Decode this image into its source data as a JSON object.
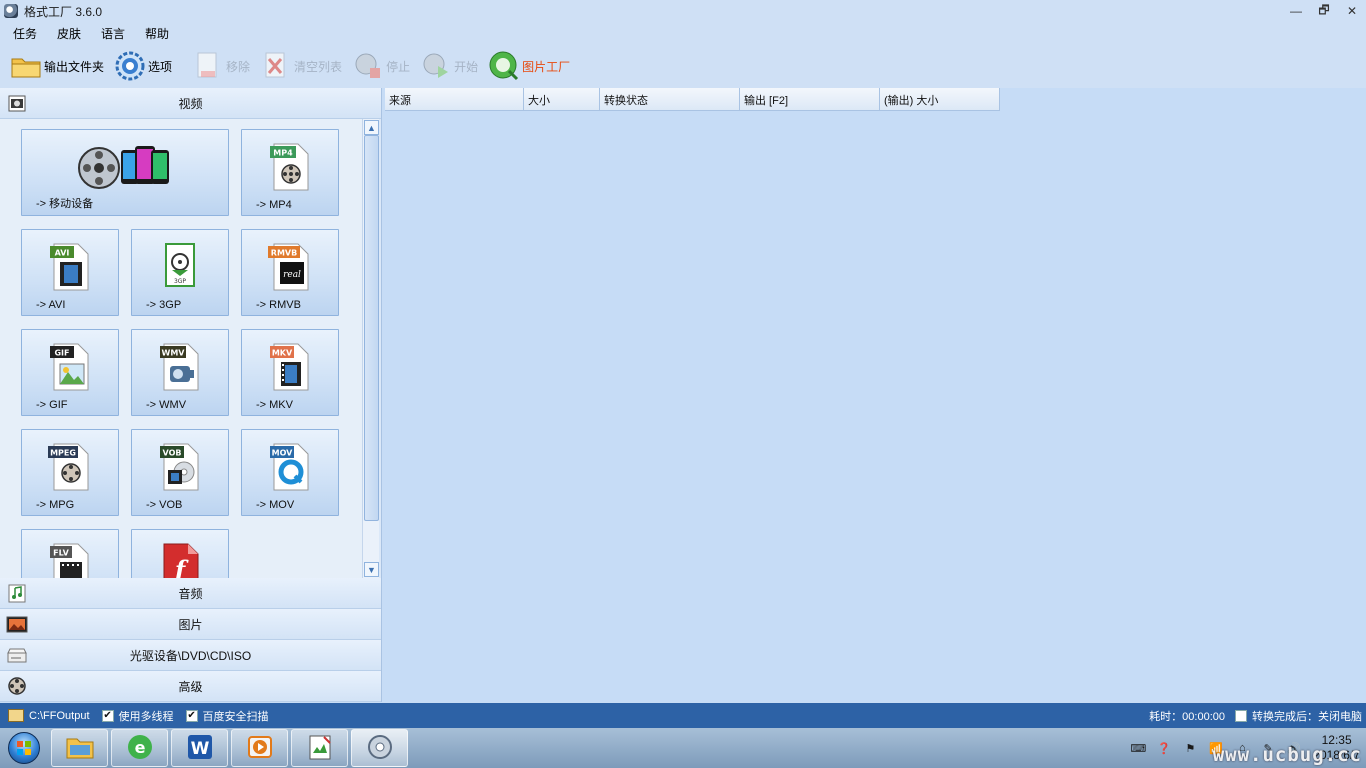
{
  "window": {
    "title": "格式工厂 3.6.0",
    "buttons": [
      "—",
      "🗗",
      "✕"
    ]
  },
  "menu": [
    "任务",
    "皮肤",
    "语言",
    "帮助"
  ],
  "toolbar": {
    "output_folder": "输出文件夹",
    "options": "选项",
    "remove": "移除",
    "clear_list": "清空列表",
    "stop": "停止",
    "start": "开始",
    "picture_factory": "图片工厂"
  },
  "left_panel": {
    "categories": {
      "video": "视频",
      "audio": "音频",
      "picture": "图片",
      "optical": "光驱设备\\DVD\\CD\\ISO",
      "advanced": "高级"
    },
    "video_buttons": [
      {
        "label": "-> 移动设备",
        "icon": "mobile-device-icon"
      },
      {
        "label": "-> MP4",
        "icon": "mp4-file-icon",
        "badge": "MP4"
      },
      {
        "label": "-> AVI",
        "icon": "avi-file-icon",
        "badge": "AVI"
      },
      {
        "label": "-> 3GP",
        "icon": "3gp-file-icon",
        "badge": "3GP"
      },
      {
        "label": "-> RMVB",
        "icon": "rmvb-file-icon",
        "badge": "RMVB"
      },
      {
        "label": "-> GIF",
        "icon": "gif-file-icon",
        "badge": "GIF"
      },
      {
        "label": "-> WMV",
        "icon": "wmv-file-icon",
        "badge": "WMV"
      },
      {
        "label": "-> MKV",
        "icon": "mkv-file-icon",
        "badge": "MKV"
      },
      {
        "label": "-> MPG",
        "icon": "mpg-file-icon",
        "badge": "MPEG"
      },
      {
        "label": "-> VOB",
        "icon": "vob-file-icon",
        "badge": "VOB"
      },
      {
        "label": "-> MOV",
        "icon": "mov-file-icon",
        "badge": "MOV"
      },
      {
        "label": "",
        "icon": "flv-file-icon",
        "badge": "FLV"
      },
      {
        "label": "",
        "icon": "swf-file-icon",
        "badge": "ƒ"
      }
    ]
  },
  "list": {
    "columns": [
      "来源",
      "大小",
      "转换状态",
      "输出 [F2]",
      "(输出) 大小"
    ]
  },
  "statusbar": {
    "output_path": "C:\\FFOutput",
    "multithread": "使用多线程",
    "baidu_scan": "百度安全扫描",
    "elapsed": "耗时：00:00:00",
    "after_convert": "转换完成后：关闭电脑"
  },
  "taskbar": {
    "clock_time": "12:35",
    "clock_date": "2018/6/7",
    "watermark": "www.ucbug.cc"
  },
  "colors": {
    "status_bar": "#2d62a6",
    "accent_label": "#e8480c",
    "disabled_label": "#a6b4c6"
  }
}
